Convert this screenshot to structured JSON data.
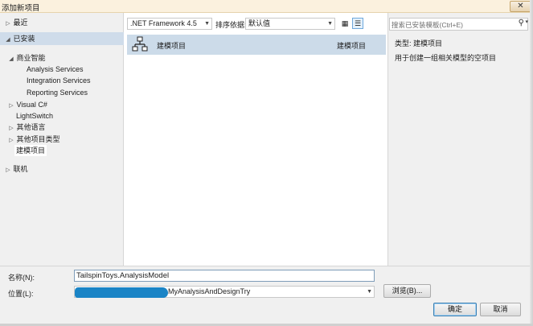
{
  "window": {
    "title": "添加新项目",
    "close_glyph": "✕"
  },
  "tree": {
    "recent": "最近",
    "installed": "已安装",
    "business_intelligence": "商业智能",
    "bi_children": [
      "Analysis Services",
      "Integration Services",
      "Reporting Services"
    ],
    "visual_csharp": "Visual C#",
    "lightswitch": "LightSwitch",
    "other_languages": "其他语言",
    "other_project_types": "其他项目类型",
    "modeling_projects": "建模项目",
    "online": "联机"
  },
  "toolbar": {
    "framework": ".NET Framework 4.5",
    "sort_label": "排序依据:",
    "sort_value": "默认值"
  },
  "templates": [
    {
      "name": "建模项目",
      "type": "建模项目"
    }
  ],
  "search": {
    "placeholder": "搜索已安装模板(Ctrl+E)"
  },
  "details": {
    "type_line": "类型:  建模项目",
    "description": "用于创建一组相关模型的空项目"
  },
  "form": {
    "name_label": "名称(N):",
    "name_value": "TailspinToys.AnalysisModel",
    "location_label": "位置(L):",
    "location_value_visible": "MyAnalysisAndDesignTry",
    "browse_label": "浏览(B)...",
    "ok_label": "确定",
    "cancel_label": "取消"
  },
  "colors": {
    "selection": "#ccdbe9",
    "pane_bg": "#f0f0f0",
    "redaction_scribble": "#1a84c6"
  },
  "icons": [
    "modeling-project-icon",
    "search-icon",
    "grid-view-icon",
    "list-view-icon",
    "chevron-down-icon",
    "expand-arrow-icon",
    "collapse-arrow-icon"
  ]
}
